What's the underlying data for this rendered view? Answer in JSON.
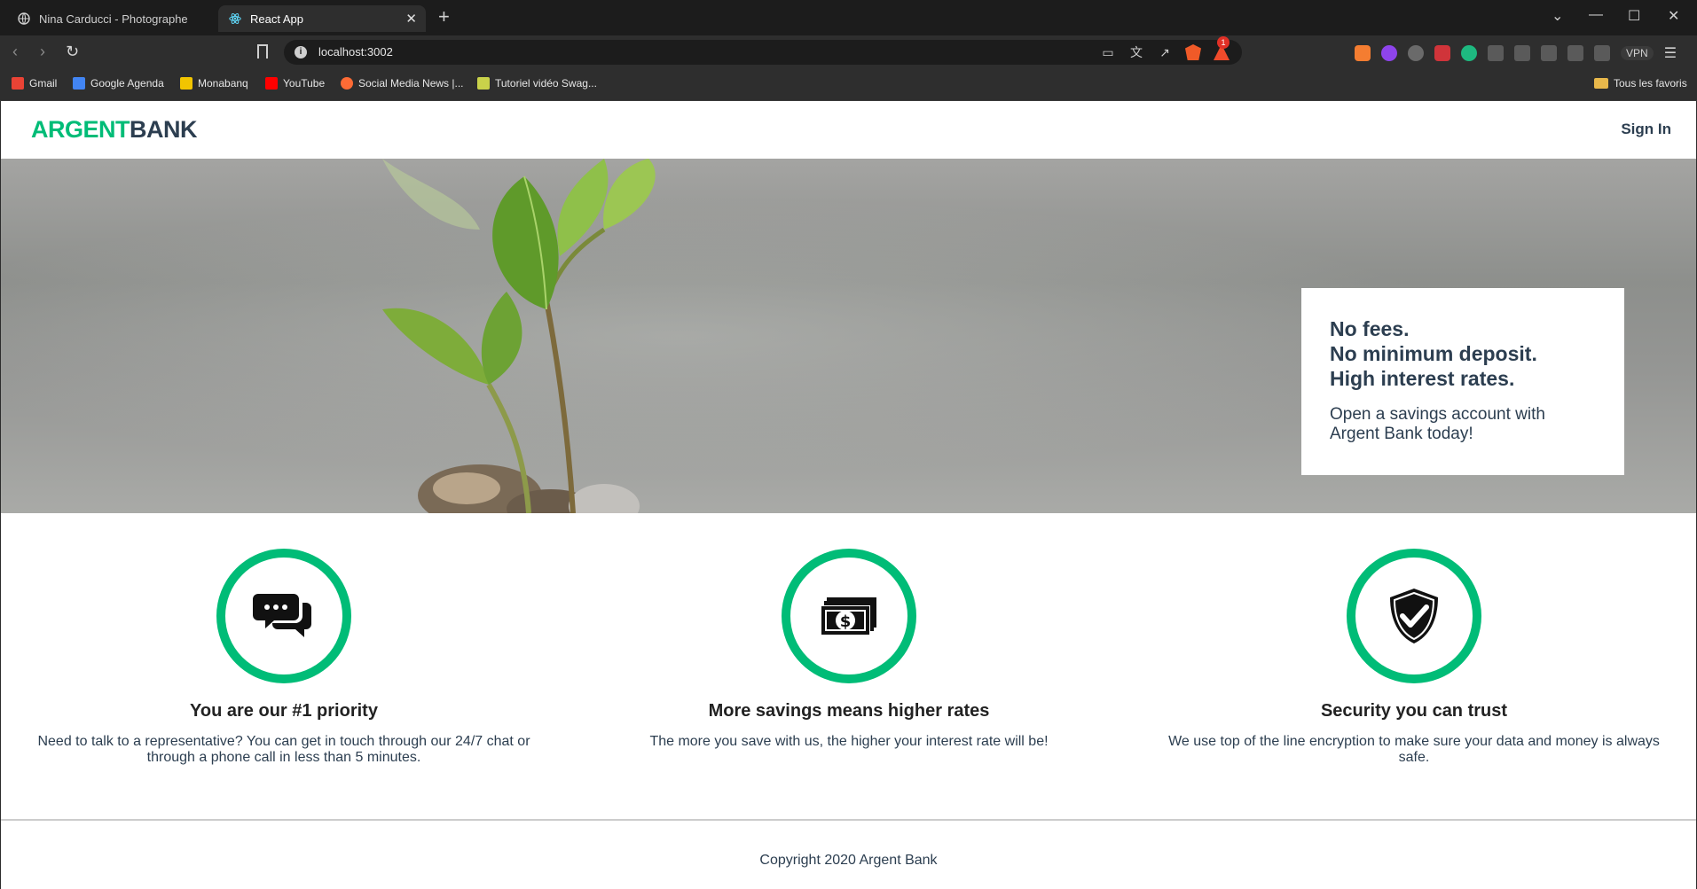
{
  "browser": {
    "tabs": [
      {
        "title": "Nina Carducci - Photographe",
        "active": false
      },
      {
        "title": "React App",
        "active": true
      }
    ],
    "url": "localhost:3002",
    "rewards_badge": "1",
    "vpn_label": "VPN",
    "bookmarks": [
      {
        "label": "Gmail",
        "icon": "gmail-icon",
        "color": "#ea4335"
      },
      {
        "label": "Google Agenda",
        "icon": "google-agenda-icon",
        "color": "#4285f4"
      },
      {
        "label": "Monabanq",
        "icon": "monabanq-icon",
        "color": "#f2c500"
      },
      {
        "label": "YouTube",
        "icon": "youtube-icon",
        "color": "#ff0000"
      },
      {
        "label": "Social Media News |...",
        "icon": "social-media-icon",
        "color": "#ff6b35"
      },
      {
        "label": "Tutoriel vidéo Swag...",
        "icon": "tutoriel-icon",
        "color": "#c9d24a"
      }
    ],
    "bookmarks_folder": "Tous les favoris"
  },
  "site": {
    "logo_part1": "ARGENT",
    "logo_part2": "BANK",
    "signin": "Sign In",
    "brand_color": "#00bc77",
    "text_color": "#2c3e50"
  },
  "hero": {
    "subtitles": [
      "No fees.",
      "No minimum deposit.",
      "High interest rates."
    ],
    "text": "Open a savings account with Argent Bank today!"
  },
  "features": [
    {
      "icon": "chat-icon",
      "title": "You are our #1 priority",
      "text": "Need to talk to a representative? You can get in touch through our 24/7 chat or through a phone call in less than 5 minutes."
    },
    {
      "icon": "money-icon",
      "title": "More savings means higher rates",
      "text": "The more you save with us, the higher your interest rate will be!"
    },
    {
      "icon": "security-icon",
      "title": "Security you can trust",
      "text": "We use top of the line encryption to make sure your data and money is always safe."
    }
  ],
  "footer": {
    "copyright": "Copyright 2020 Argent Bank"
  }
}
